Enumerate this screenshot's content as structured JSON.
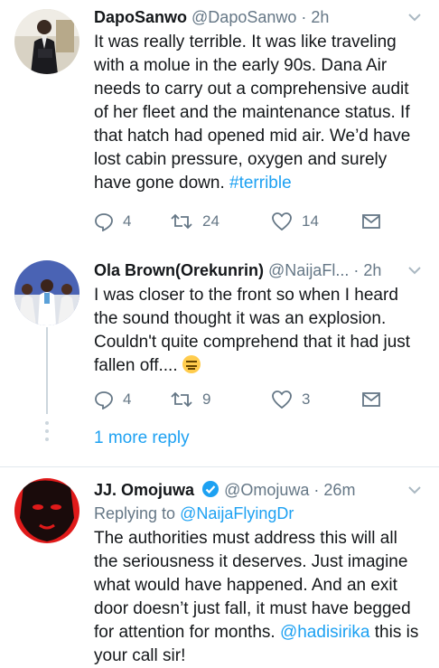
{
  "tweets": [
    {
      "name": "DapoSanwo",
      "handle": "@DapoSanwo",
      "separator": "·",
      "time": "2h",
      "text": "It was really terrible. It was like traveling with a molue in the early 90s. Dana Air needs to carry out a comprehensive audit of her fleet and the maintenance status. If that hatch had opened mid air. We’d have lost cabin pressure, oxygen and surely have gone down.",
      "hashtag": "#terrible",
      "replies": "4",
      "retweets": "24",
      "likes": "14",
      "avatar_icon": "user-photo"
    },
    {
      "name": "Ola Brown(Orekunrin)",
      "handle": "@NaijaFl...",
      "separator": "·",
      "time": "2h",
      "text": "I was closer to the front so when I heard the sound thought it was an explosion. Couldn't quite comprehend that it had just fallen off....",
      "emoji": "expressionless-face",
      "replies": "4",
      "retweets": "9",
      "likes": "3",
      "avatar_icon": "group-photo"
    },
    {
      "name": "JJ. Omojuwa",
      "handle": "@Omojuwa",
      "separator": "·",
      "time": "26m",
      "verified": true,
      "reply_prefix": "Replying to",
      "reply_to": "@NaijaFlyingDr",
      "text": "The authorities must address this will all the seriousness it deserves. Just imagine what would have happened. And an exit door doesn’t just fall, it must have begged for attention for months.",
      "mention": "@hadisirika",
      "text_tail": " this is your call sir!",
      "avatar_icon": "red-portrait"
    }
  ],
  "thread": {
    "more_replies": "1 more reply"
  },
  "colors": {
    "link": "#1da1f2",
    "secondary": "#657786",
    "divider": "#e1e8ed",
    "thread_line": "#ccd6dd"
  }
}
